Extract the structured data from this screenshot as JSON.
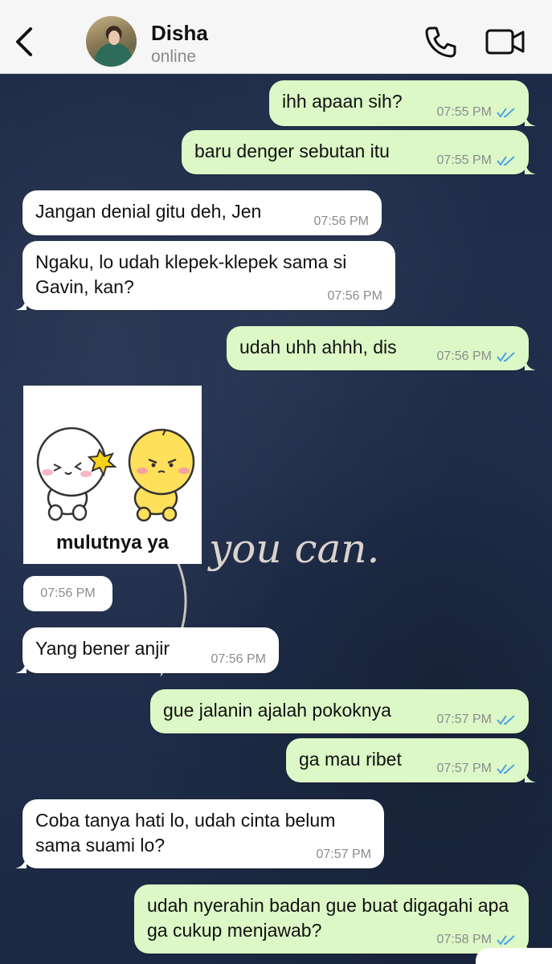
{
  "header": {
    "contact_name": "Disha",
    "status": "online"
  },
  "messages": [
    {
      "id": 0,
      "direction": "out",
      "text": "ihh apaan sih?",
      "time": "07:55 PM",
      "read": true
    },
    {
      "id": 1,
      "direction": "out",
      "text": "baru denger sebutan itu",
      "time": "07:55 PM",
      "read": true
    },
    {
      "id": 2,
      "direction": "in",
      "text": "Jangan denial gitu deh, Jen",
      "time": "07:56 PM"
    },
    {
      "id": 3,
      "direction": "in",
      "text": "Ngaku, lo udah klepek-klepek sama si Gavin, kan?",
      "time": "07:56 PM"
    },
    {
      "id": 4,
      "direction": "out",
      "text": "udah uhh ahhh, dis",
      "time": "07:56 PM",
      "read": true
    },
    {
      "id": 5,
      "direction": "in",
      "type": "sticker",
      "caption": "mulutnya ya",
      "time": "07:56 PM"
    },
    {
      "id": 6,
      "direction": "in",
      "text": "Yang bener anjir",
      "time": "07:56 PM"
    },
    {
      "id": 7,
      "direction": "out",
      "text": "gue jalanin ajalah pokoknya",
      "time": "07:57 PM",
      "read": true
    },
    {
      "id": 8,
      "direction": "out",
      "text": "ga mau ribet",
      "time": "07:57 PM",
      "read": true
    },
    {
      "id": 9,
      "direction": "in",
      "text": "Coba tanya hati lo, udah cinta belum sama suami lo?",
      "time": "07:57 PM"
    },
    {
      "id": 10,
      "direction": "out",
      "text": "udah nyerahin badan gue buat digagahi apa ga cukup menjawab?",
      "time": "07:58 PM",
      "read": true
    }
  ],
  "wallpaper": {
    "script_text": "you can."
  },
  "colors": {
    "outgoing_bubble": "#dcf8c6",
    "incoming_bubble": "#ffffff",
    "read_ticks": "#4fa3e0",
    "icon": "#111111"
  }
}
